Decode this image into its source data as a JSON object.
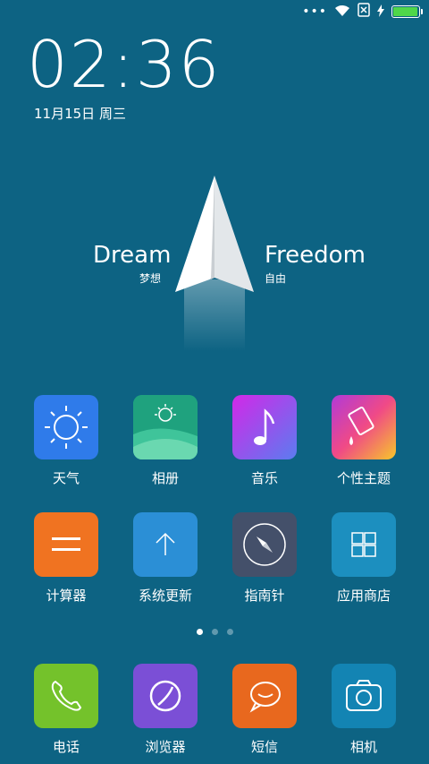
{
  "status_bar": {
    "more": "•••",
    "icons": [
      "wifi-icon",
      "sim-x-icon",
      "charging-icon",
      "battery-icon"
    ],
    "battery_level": 0.95,
    "battery_color": "#4fd64a"
  },
  "clock": {
    "time": "02:36",
    "date": "11月15日 周三"
  },
  "wallpaper": {
    "left_title": "Dream",
    "left_sub": "梦想",
    "right_title": "Freedom",
    "right_sub": "自由"
  },
  "apps": [
    {
      "label": "天气",
      "icon": "weather-sun-icon",
      "color": "#2f7bea"
    },
    {
      "label": "相册",
      "icon": "gallery-icon",
      "color": "#1bb184"
    },
    {
      "label": "音乐",
      "icon": "music-note-icon",
      "color": "#c42fe0"
    },
    {
      "label": "个性主题",
      "icon": "theme-paint-icon",
      "color": "#e0548a"
    },
    {
      "label": "计算器",
      "icon": "calculator-icon",
      "color": "#f07321"
    },
    {
      "label": "系统更新",
      "icon": "update-arrow-icon",
      "color": "#2b8fd6"
    },
    {
      "label": "指南针",
      "icon": "compass-icon",
      "color": "#44506a"
    },
    {
      "label": "应用商店",
      "icon": "app-store-icon",
      "color": "#1c8fbf"
    }
  ],
  "pager": {
    "pages": 3,
    "current": 1
  },
  "dock": [
    {
      "label": "电话",
      "icon": "phone-icon",
      "color": "#74c22b"
    },
    {
      "label": "浏览器",
      "icon": "browser-icon",
      "color": "#7b4fd6"
    },
    {
      "label": "短信",
      "icon": "message-icon",
      "color": "#e8681e"
    },
    {
      "label": "相机",
      "icon": "camera-icon",
      "color": "#1384b3"
    }
  ]
}
